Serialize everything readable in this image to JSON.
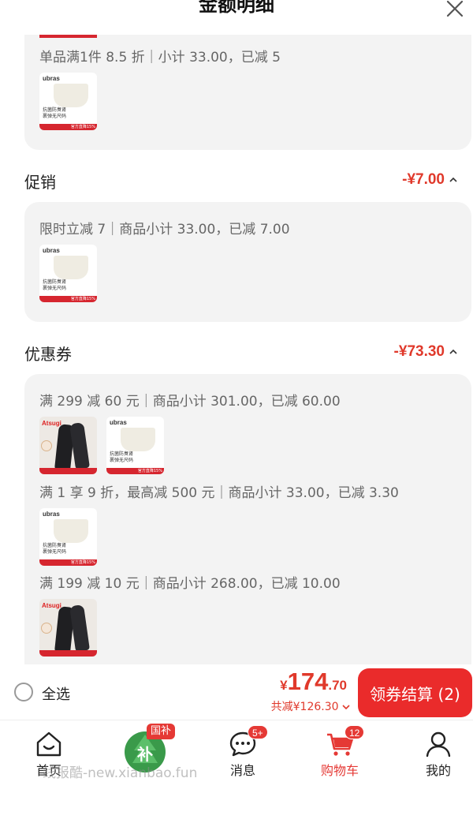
{
  "header": {
    "title": "金额明细"
  },
  "top_card": {
    "rule": "单品满1件 8.5 折｜小计 33.00，已减 5"
  },
  "promotion": {
    "title": "促销",
    "amount": "-¥7.00",
    "rule": "限时立减 7｜商品小计 33.00，已减 7.00"
  },
  "coupon": {
    "title": "优惠券",
    "amount": "-¥73.30",
    "rules": [
      "满 299 减 60 元｜商品小计 301.00，已减 60.00",
      "满 1 享 9 折，最高减 500 元｜商品小计 33.00，已减 3.30",
      "满 199 减 10 元｜商品小计 268.00，已减 10.00"
    ]
  },
  "product_thumbs": {
    "ubras_brand": "ubras",
    "ubras_text": "抗菌防臭肾\n裹弹无尺码",
    "ubras_strip": "官方直降15%",
    "legs_brand": "Atsugi"
  },
  "checkout": {
    "select_all_label": "全选",
    "currency": "¥",
    "price_int": "174",
    "price_dec": ".70",
    "discount": "共减¥126.30",
    "button_label": "领券结算 (2)"
  },
  "tabbar": {
    "home": "首页",
    "subsidy_tag": "国补",
    "messages": "消息",
    "messages_badge": "5+",
    "cart": "购物车",
    "cart_badge": "12",
    "mine": "我的"
  },
  "watermark": "线报酷-new.xianbao.fun",
  "colors": {
    "accent": "#e0392b",
    "button": "#ea2b2b",
    "card": "#f3f3f3"
  }
}
